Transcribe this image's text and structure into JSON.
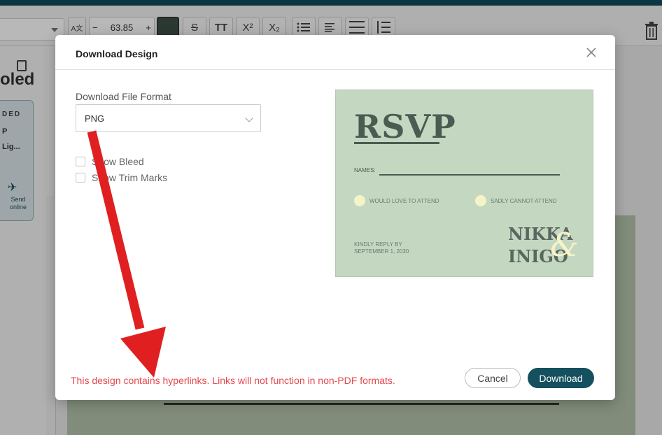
{
  "toolbar": {
    "font_size": "63.85",
    "minus": "−",
    "plus": "+",
    "strikethrough": "S",
    "uppercase": "TT",
    "superscript": "X²",
    "subscript": "X₂",
    "case_icon": "A文"
  },
  "left": {
    "title_fragment": "oled",
    "card_line1": "DED",
    "card_line2": "P",
    "card_line3": "Lig...",
    "send_online": "Send online"
  },
  "modal": {
    "title": "Download Design",
    "format_label": "Download File Format",
    "format_value": "PNG",
    "show_bleed": "Show Bleed",
    "show_trim": "Show Trim Marks",
    "warning": "This design contains hyperlinks. Links will not function in non-PDF formats.",
    "cancel": "Cancel",
    "download": "Download"
  },
  "preview": {
    "heading": "RSVP",
    "names_label": "NAMES:",
    "option1": "WOULD LOVE TO ATTEND",
    "option2": "SADLY CANNOT ATTEND",
    "reply_line1": "KINDLY REPLY BY",
    "reply_line2": "SEPTEMBER 1, 2030",
    "name1": "NIKKA",
    "name2": "INIGO",
    "ampersand": "&"
  },
  "colors": {
    "accent": "#14505e",
    "warning": "#e5484d",
    "preview_bg": "#c4d8c1",
    "arrow": "#e02020"
  }
}
